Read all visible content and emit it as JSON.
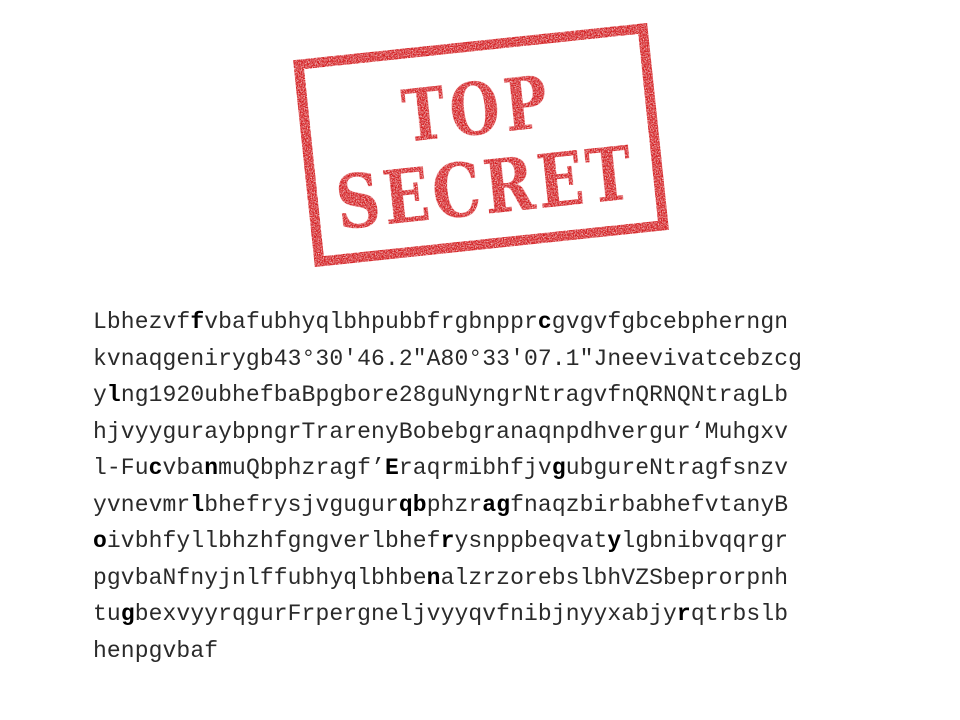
{
  "stamp": {
    "line1": "TOP",
    "line2": "SECRET",
    "color": "#d11317"
  },
  "cipher_lines": [
    [
      {
        "t": "Lbhezvf"
      },
      {
        "t": "f",
        "b": true
      },
      {
        "t": "vbafubhyqlbhpubbfrgbnppr"
      },
      {
        "t": "c",
        "b": true
      },
      {
        "t": "gvgvfgbcebpherngn"
      }
    ],
    [
      {
        "t": "kvnaqgenirygb43°30'46.2\"A80°33'07.1\"Jneevivatcebzcg"
      }
    ],
    [
      {
        "t": "y"
      },
      {
        "t": "l",
        "b": true
      },
      {
        "t": "ng1920ubhefbaBpgbore28guNyngrNtragvfnQRNQNtragLb"
      }
    ],
    [
      {
        "t": "hjvyyguraybpngrTrarenyBobebgranaqnpdhvergur‘Muhgxv"
      }
    ],
    [
      {
        "t": "l-Fu"
      },
      {
        "t": "c",
        "b": true
      },
      {
        "t": "vba"
      },
      {
        "t": "n",
        "b": true
      },
      {
        "t": "muQbphzragf’"
      },
      {
        "t": "E",
        "b": true
      },
      {
        "t": "raqrmibhfjv"
      },
      {
        "t": "g",
        "b": true
      },
      {
        "t": "ubgureNtragfsnzv"
      }
    ],
    [
      {
        "t": "yvnevmr"
      },
      {
        "t": "l",
        "b": true
      },
      {
        "t": "bhefrysjvgugur"
      },
      {
        "t": "qb",
        "b": true
      },
      {
        "t": "phzr"
      },
      {
        "t": "ag",
        "b": true
      },
      {
        "t": "fnaqzbirbabhefvtanyB"
      }
    ],
    [
      {
        "t": "o",
        "b": true
      },
      {
        "t": "ivbhfyllbhzhfgngverlbhef"
      },
      {
        "t": "r",
        "b": true
      },
      {
        "t": "ysnppbeqvat"
      },
      {
        "t": "y",
        "b": true
      },
      {
        "t": "lgbnibvqqrgr"
      }
    ],
    [
      {
        "t": "pgvbaNfnyjnlffubhyqlbhbe"
      },
      {
        "t": "n",
        "b": true
      },
      {
        "t": "alzrzorebslbhVZSbeprorpnh"
      }
    ],
    [
      {
        "t": "tu"
      },
      {
        "t": "g",
        "b": true
      },
      {
        "t": "bexvyyrqgurFrpergneljvyyqvfnibjnyyxabjy"
      },
      {
        "t": "r",
        "b": true
      },
      {
        "t": "qtrbslb"
      }
    ],
    [
      {
        "t": "henpgvbaf"
      }
    ]
  ]
}
